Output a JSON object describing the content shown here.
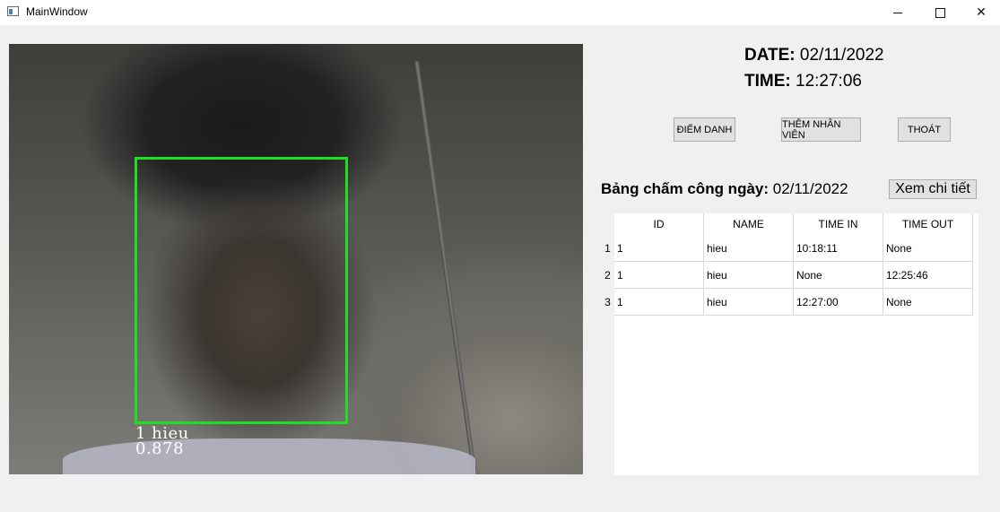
{
  "window": {
    "title": "MainWindow"
  },
  "camera": {
    "label_line1": "1 hieu",
    "label_line2": "0.878",
    "box_color": "#1ee01e"
  },
  "header": {
    "date_label": "DATE:",
    "date_value": "02/11/2022",
    "time_label": "TIME:",
    "time_value": "12:27:06"
  },
  "buttons": {
    "attendance": "ĐIỂM DANH",
    "add_employee": "THÊM NHÂN VIÊN",
    "exit": "THOÁT",
    "details": "Xem chi tiết"
  },
  "table": {
    "title_label": "Bảng chấm công ngày:",
    "title_date": "02/11/2022",
    "columns": [
      "ID",
      "NAME",
      "TIME IN",
      "TIME OUT"
    ],
    "rows": [
      {
        "num": "1",
        "cells": [
          "1",
          "hieu",
          "10:18:11",
          "None"
        ]
      },
      {
        "num": "2",
        "cells": [
          "1",
          "hieu",
          "None",
          "12:25:46"
        ]
      },
      {
        "num": "3",
        "cells": [
          "1",
          "hieu",
          "12:27:00",
          "None"
        ]
      }
    ]
  }
}
